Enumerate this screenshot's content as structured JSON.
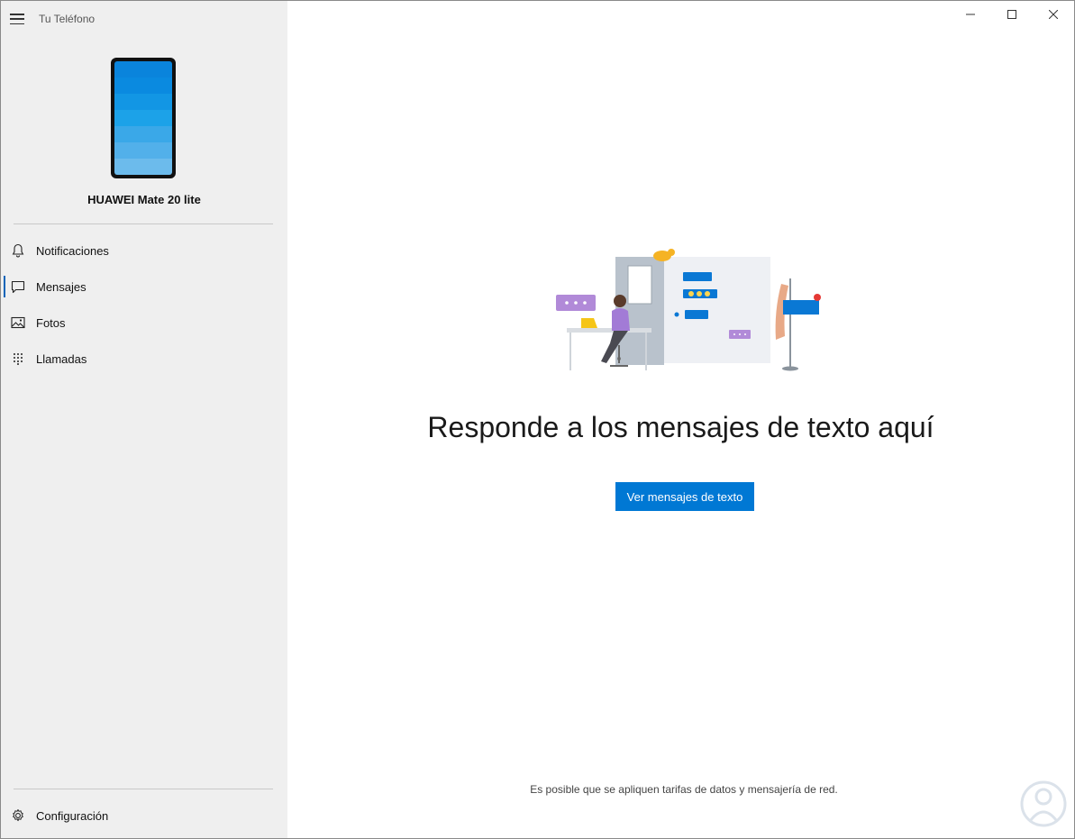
{
  "app": {
    "title": "Tu Teléfono",
    "device_name": "HUAWEI Mate 20 lite",
    "phone_screen_colors": [
      "#0a84dc",
      "#0a8ae0",
      "#1296e4",
      "#1ca2e8",
      "#3aa8e8",
      "#52b0ea",
      "#6cbbec"
    ]
  },
  "sidebar": {
    "items": [
      {
        "label": "Notificaciones",
        "icon": "bell-icon",
        "active": false
      },
      {
        "label": "Mensajes",
        "icon": "chat-icon",
        "active": true
      },
      {
        "label": "Fotos",
        "icon": "photo-icon",
        "active": false
      },
      {
        "label": "Llamadas",
        "icon": "dialpad-icon",
        "active": false
      }
    ],
    "settings_label": "Configuración"
  },
  "main": {
    "headline": "Responde a los mensajes de texto aquí",
    "button_label": "Ver mensajes de texto",
    "disclaimer": "Es posible que se apliquen tarifas de datos y mensajería de red."
  },
  "colors": {
    "accent": "#0078d4",
    "sidebar_bg": "#efefef",
    "active_indicator": "#0a64b8"
  }
}
